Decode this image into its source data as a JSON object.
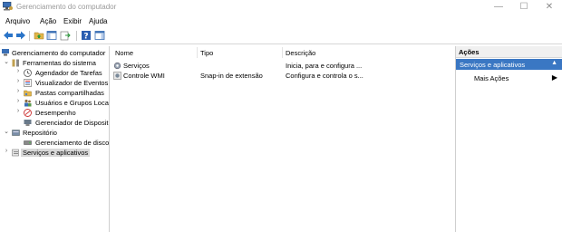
{
  "window": {
    "title": "Gerenciamento do computador",
    "minimize": "—",
    "maximize": "☐",
    "close": "✕"
  },
  "menu": [
    "Arquivo",
    "Ação",
    "Exibir",
    "Ajuda"
  ],
  "tree": [
    {
      "label": "Gerenciamento do computador",
      "expander": "",
      "indent": 0
    },
    {
      "label": "Ferramentas do sistema",
      "expander": "⌄",
      "indent": 1
    },
    {
      "label": "Agendador de Tarefas",
      "expander": "›",
      "indent": 2
    },
    {
      "label": "Visualizador de Eventos",
      "expander": "›",
      "indent": 2
    },
    {
      "label": "Pastas compartilhadas",
      "expander": "›",
      "indent": 2
    },
    {
      "label": "Usuários e Grupos Locais",
      "expander": "›",
      "indent": 2
    },
    {
      "label": "Desempenho",
      "expander": "›",
      "indent": 2
    },
    {
      "label": "Gerenciador de Dispositivos",
      "expander": "",
      "indent": 2
    },
    {
      "label": "Repositório",
      "expander": "⌄",
      "indent": 1
    },
    {
      "label": "Gerenciamento de disco",
      "expander": "",
      "indent": 2
    },
    {
      "label": "Serviços e aplicativos",
      "expander": "›",
      "indent": 1,
      "selected": true
    }
  ],
  "list": {
    "columns": [
      "Nome",
      "Tipo",
      "Descrição"
    ],
    "rows": [
      {
        "name": "Serviços",
        "type": "",
        "description": "Inicia, para e configura ..."
      },
      {
        "name": "Controle WMI",
        "type": "Snap-in de extensão",
        "description": "Configura e controla o s..."
      }
    ]
  },
  "actions": {
    "header": "Ações",
    "section": "Serviços e aplicativos",
    "section_caret": "▲",
    "item": "Mais Ações",
    "item_arrow": "▶"
  }
}
